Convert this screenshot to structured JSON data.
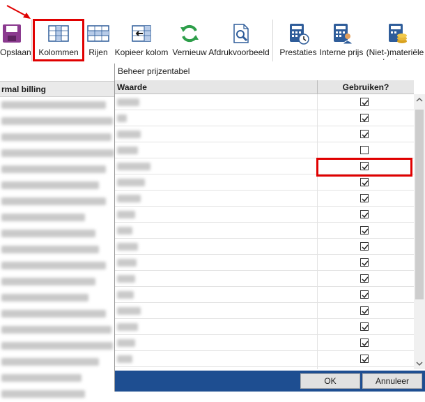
{
  "ribbon": {
    "buttons": [
      {
        "label": "Opslaan",
        "icon": "save-icon"
      },
      {
        "label": "Kolommen",
        "icon": "columns-icon"
      },
      {
        "label": "Rijen",
        "icon": "rows-icon"
      },
      {
        "label": "Kopieer kolom",
        "icon": "copy-column-icon"
      },
      {
        "label": "Vernieuw",
        "icon": "refresh-icon"
      },
      {
        "label": "Afdrukvoorbeeld",
        "icon": "print-preview-icon"
      },
      {
        "label": "Prestaties",
        "icon": "calculator-clock-icon"
      },
      {
        "label": "Interne prijs",
        "icon": "calculator-user-icon"
      },
      {
        "label": "(Niet-)materiële kosten",
        "icon": "calculator-coins-icon"
      }
    ]
  },
  "background_grid": {
    "header": "rmal billing"
  },
  "dialog": {
    "title": "Beheer prijzentabel",
    "columns": {
      "waarde": "Waarde",
      "gebruiken": "Gebruiken?"
    },
    "rows": [
      {
        "checked": true
      },
      {
        "checked": true
      },
      {
        "checked": true
      },
      {
        "checked": false
      },
      {
        "checked": true
      },
      {
        "checked": true
      },
      {
        "checked": true
      },
      {
        "checked": true
      },
      {
        "checked": true
      },
      {
        "checked": true
      },
      {
        "checked": true
      },
      {
        "checked": true
      },
      {
        "checked": true
      },
      {
        "checked": true
      },
      {
        "checked": true
      },
      {
        "checked": true
      },
      {
        "checked": true
      },
      {
        "checked": true
      }
    ],
    "ok_label": "OK",
    "cancel_label": "Annuleer"
  },
  "colors": {
    "highlight": "#e00000",
    "footer": "#1e4e91",
    "icon_blue": "#2f5d9a",
    "icon_green": "#2e9e4a",
    "save_purple": "#8b3a8f"
  }
}
